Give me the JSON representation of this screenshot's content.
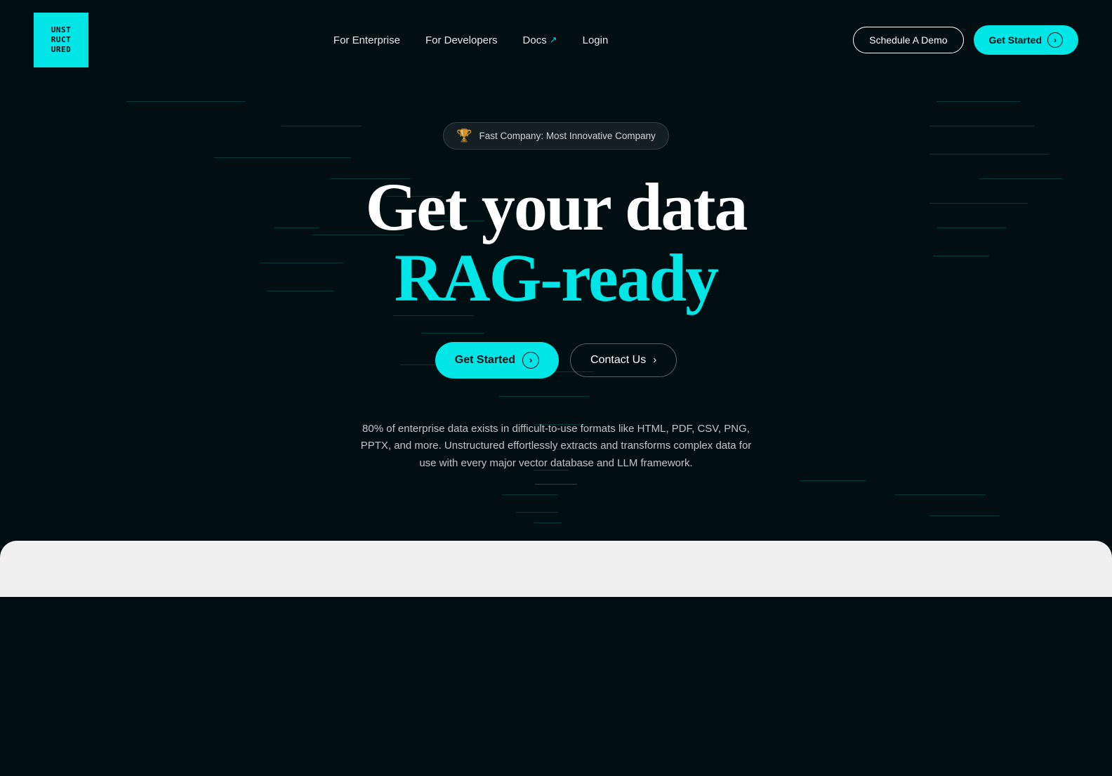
{
  "logo": {
    "text": "UNST\nRUCT\nURED"
  },
  "nav": {
    "links": [
      {
        "label": "For Enterprise",
        "has_arrow": false
      },
      {
        "label": "For Developers",
        "has_arrow": false
      },
      {
        "label": "Docs",
        "has_arrow": true
      },
      {
        "label": "Login",
        "has_arrow": false
      }
    ],
    "schedule_demo": "Schedule A Demo",
    "get_started": "Get Started"
  },
  "hero": {
    "badge_text": "Fast Company: Most Innovative Company",
    "headline_line1": "Get your data",
    "headline_line2": "RAG-ready",
    "cta_primary": "Get Started",
    "cta_secondary": "Contact Us",
    "description": "80% of enterprise data exists in difficult-to-use formats like HTML, PDF, CSV, PNG, PPTX, and more. Unstructured effortlessly extracts and transforms complex data for use with every major vector database and LLM framework."
  },
  "colors": {
    "accent": "#00e5e5",
    "bg": "#020f12",
    "nav_border": "#ffffff",
    "text_muted": "rgba(255,255,255,0.75)"
  }
}
